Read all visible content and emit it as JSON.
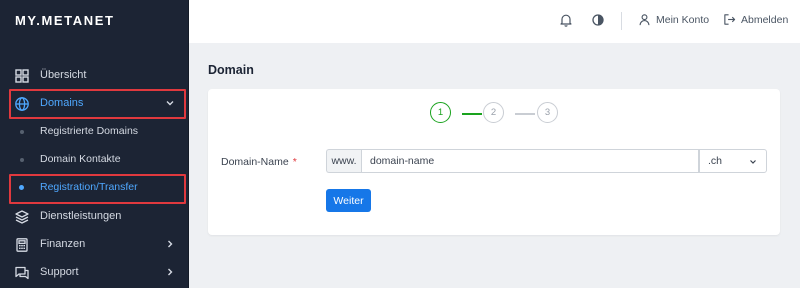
{
  "app": {
    "logo": "MY.METANET"
  },
  "sidebar": {
    "items": [
      {
        "label": "Übersicht",
        "icon": "grid-icon"
      },
      {
        "label": "Domains",
        "icon": "globe-icon",
        "active": true,
        "expanded": true
      },
      {
        "label": "Registrierte Domains"
      },
      {
        "label": "Domain Kontakte"
      },
      {
        "label": "Registration/Transfer",
        "active": true
      },
      {
        "label": "Dienstleistungen",
        "icon": "layers-icon"
      },
      {
        "label": "Finanzen",
        "icon": "calculator-icon"
      },
      {
        "label": "Support",
        "icon": "chat-icon"
      }
    ]
  },
  "topbar": {
    "account_label": "Mein Konto",
    "logout_label": "Abmelden"
  },
  "main": {
    "title": "Domain",
    "steps": [
      "1",
      "2",
      "3"
    ],
    "current_step": 1,
    "form": {
      "label": "Domain-Name",
      "required_mark": "*",
      "prefix": "www.",
      "domain_value": "domain-name",
      "tld_value": ".ch",
      "submit_label": "Weiter"
    }
  },
  "colors": {
    "sidebar_bg": "#1c2434",
    "accent": "#1677e8",
    "active_text": "#4fa8ff",
    "step_active": "#1aa31e",
    "highlight": "#e0393e"
  }
}
